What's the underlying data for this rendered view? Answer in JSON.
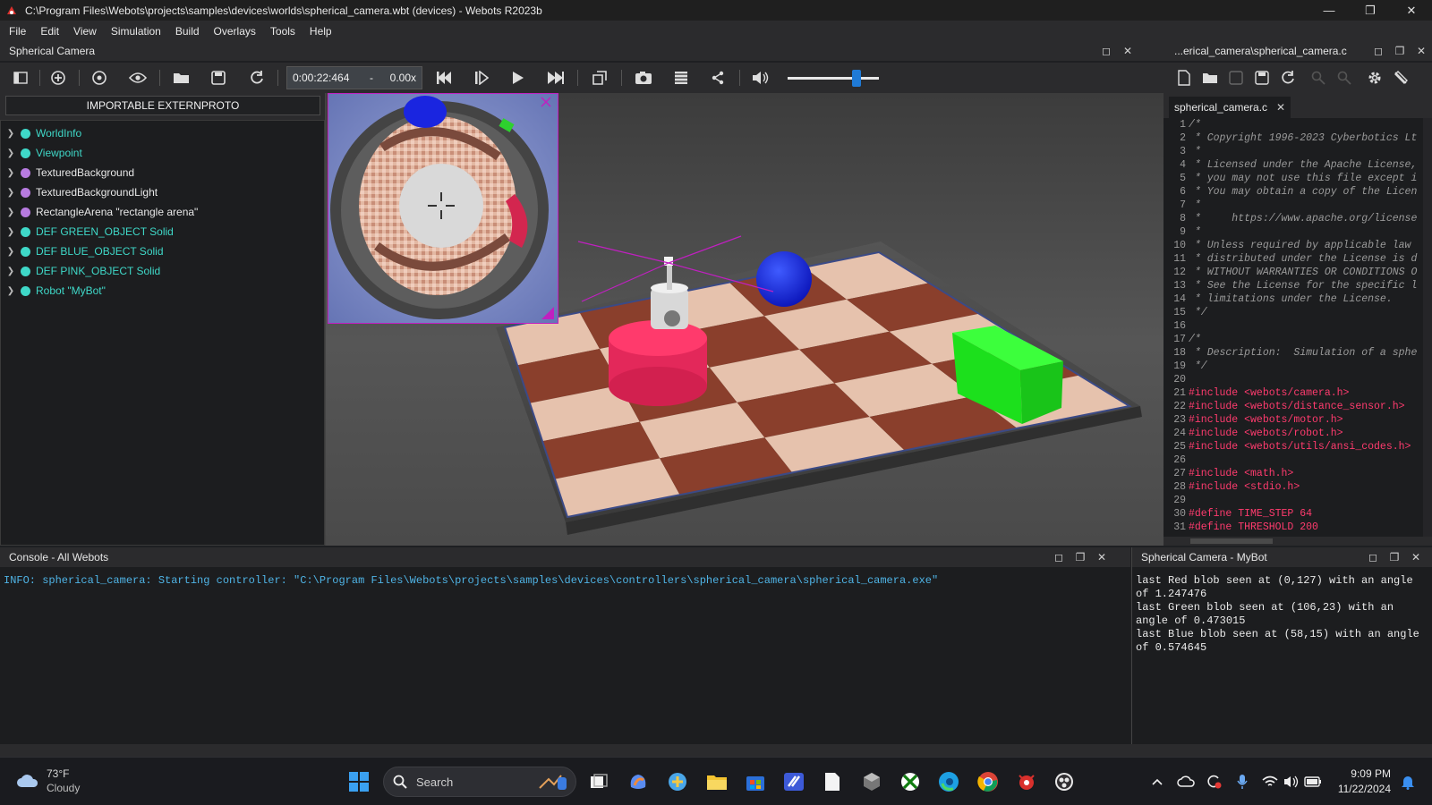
{
  "window": {
    "title": "C:\\Program Files\\Webots\\projects\\samples\\devices\\worlds\\spherical_camera.wbt (devices) - Webots R2023b"
  },
  "menu": [
    "File",
    "Edit",
    "View",
    "Simulation",
    "Build",
    "Overlays",
    "Tools",
    "Help"
  ],
  "scene_dock": {
    "title": "Spherical Camera"
  },
  "toolbar": {
    "sim_time": "0:00:22:464",
    "time_sep": "-",
    "speed": "0.00x",
    "volume_percent": 75
  },
  "scene_tree": {
    "import_button": "IMPORTABLE EXTERNPROTO",
    "nodes": [
      {
        "label": "WorldInfo",
        "color": "#3fd8c8",
        "text_color": "#3fd8c8"
      },
      {
        "label": "Viewpoint",
        "color": "#3fd8c8",
        "text_color": "#3fd8c8"
      },
      {
        "label": "TexturedBackground",
        "color": "#b77be0",
        "text_color": "#e8e8e8"
      },
      {
        "label": "TexturedBackgroundLight",
        "color": "#b77be0",
        "text_color": "#e8e8e8"
      },
      {
        "label": "RectangleArena \"rectangle arena\"",
        "color": "#b77be0",
        "text_color": "#e8e8e8"
      },
      {
        "label": "DEF GREEN_OBJECT Solid",
        "color": "#3fd8c8",
        "text_color": "#3fd8c8"
      },
      {
        "label": "DEF BLUE_OBJECT Solid",
        "color": "#3fd8c8",
        "text_color": "#3fd8c8"
      },
      {
        "label": "DEF PINK_OBJECT Solid",
        "color": "#3fd8c8",
        "text_color": "#3fd8c8"
      },
      {
        "label": "Robot \"MyBot\"",
        "color": "#3fd8c8",
        "text_color": "#3fd8c8"
      }
    ]
  },
  "editor": {
    "dock_title": "...erical_camera\\spherical_camera.c",
    "tab_label": "spherical_camera.c",
    "lines": [
      {
        "n": "1",
        "text": "/*",
        "kind": "comment"
      },
      {
        "n": "2",
        "text": " * Copyright 1996-2023 Cyberbotics Lt",
        "kind": "comment"
      },
      {
        "n": "3",
        "text": " *",
        "kind": "comment"
      },
      {
        "n": "4",
        "text": " * Licensed under the Apache License,",
        "kind": "comment"
      },
      {
        "n": "5",
        "text": " * you may not use this file except i",
        "kind": "comment"
      },
      {
        "n": "6",
        "text": " * You may obtain a copy of the Licen",
        "kind": "comment"
      },
      {
        "n": "7",
        "text": " *",
        "kind": "comment"
      },
      {
        "n": "8",
        "text": " *     https://www.apache.org/license",
        "kind": "comment"
      },
      {
        "n": "9",
        "text": " *",
        "kind": "comment"
      },
      {
        "n": "10",
        "text": " * Unless required by applicable law",
        "kind": "comment"
      },
      {
        "n": "11",
        "text": " * distributed under the License is d",
        "kind": "comment"
      },
      {
        "n": "12",
        "text": " * WITHOUT WARRANTIES OR CONDITIONS O",
        "kind": "comment"
      },
      {
        "n": "13",
        "text": " * See the License for the specific l",
        "kind": "comment"
      },
      {
        "n": "14",
        "text": " * limitations under the License.",
        "kind": "comment"
      },
      {
        "n": "15",
        "text": " */",
        "kind": "comment"
      },
      {
        "n": "16",
        "text": "",
        "kind": "plain"
      },
      {
        "n": "17",
        "text": "/*",
        "kind": "comment"
      },
      {
        "n": "18",
        "text": " * Description:  Simulation of a sphe",
        "kind": "comment"
      },
      {
        "n": "19",
        "text": " */",
        "kind": "comment"
      },
      {
        "n": "20",
        "text": "",
        "kind": "plain"
      },
      {
        "n": "21",
        "text": "#include <webots/camera.h>",
        "kind": "pre"
      },
      {
        "n": "22",
        "text": "#include <webots/distance_sensor.h>",
        "kind": "pre"
      },
      {
        "n": "23",
        "text": "#include <webots/motor.h>",
        "kind": "pre"
      },
      {
        "n": "24",
        "text": "#include <webots/robot.h>",
        "kind": "pre"
      },
      {
        "n": "25",
        "text": "#include <webots/utils/ansi_codes.h>",
        "kind": "pre"
      },
      {
        "n": "26",
        "text": "",
        "kind": "plain"
      },
      {
        "n": "27",
        "text": "#include <math.h>",
        "kind": "pre"
      },
      {
        "n": "28",
        "text": "#include <stdio.h>",
        "kind": "pre"
      },
      {
        "n": "29",
        "text": "",
        "kind": "plain"
      },
      {
        "n": "30",
        "text": "#define TIME_STEP 64",
        "kind": "pre"
      },
      {
        "n": "31",
        "text": "#define THRESHOLD 200",
        "kind": "pre"
      }
    ]
  },
  "console": {
    "title": "Console - All Webots",
    "line": "INFO: spherical_camera: Starting controller: \"C:\\Program Files\\Webots\\projects\\samples\\devices\\controllers\\spherical_camera\\spherical_camera.exe\""
  },
  "robot_console": {
    "title": "Spherical Camera - MyBot",
    "lines": [
      "last Red blob seen at (0,127) with an angle of 1.247476",
      "last Green blob seen at (106,23) with an angle of 0.473015",
      "last Blue blob seen at (58,15) with an angle of 0.574645"
    ]
  },
  "taskbar": {
    "temperature": "73°F",
    "condition": "Cloudy",
    "search_placeholder": "Search",
    "time": "9:09 PM",
    "date": "11/22/2024"
  }
}
